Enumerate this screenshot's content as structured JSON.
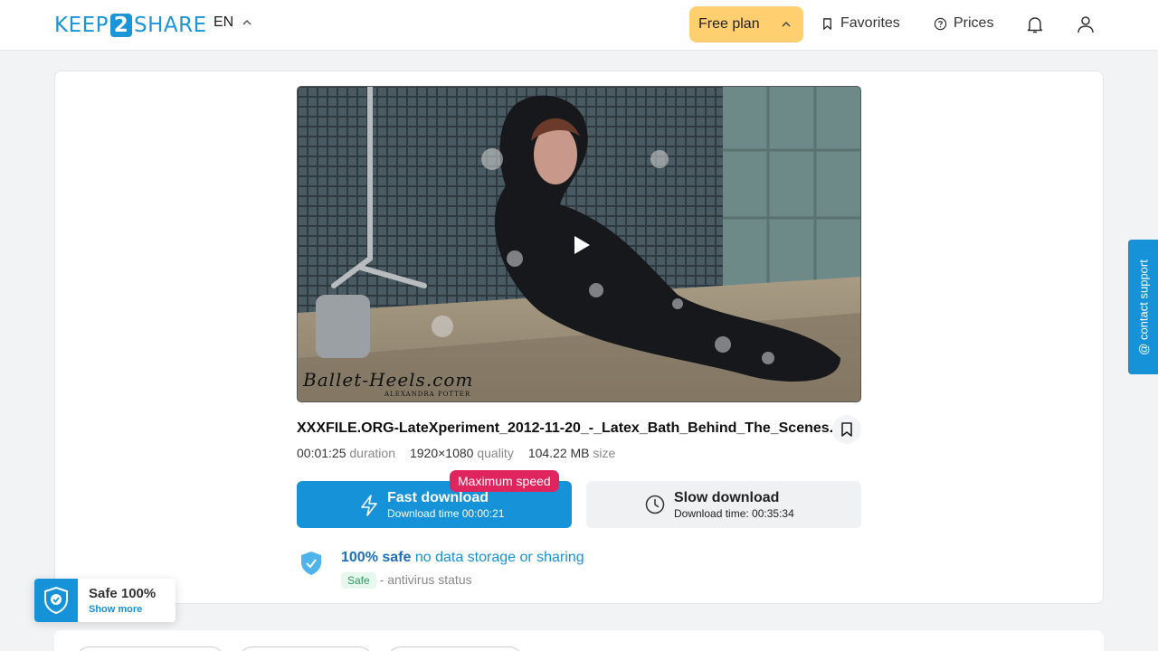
{
  "header": {
    "logo_left": "KEEP",
    "logo_mid": "2",
    "logo_right": "SHARE",
    "language": "EN",
    "plan_label": "Free plan",
    "favorites_label": "Favorites",
    "prices_label": "Prices"
  },
  "file": {
    "name": "XXXFILE.ORG-LateXperiment_2012-11-20_-_Latex_Bath_Behind_The_Scenes....",
    "duration_value": "00:01:25",
    "duration_label": "duration",
    "quality_value": "1920×1080",
    "quality_label": "quality",
    "size_value": "104.22 MB",
    "size_label": "size",
    "thumbnail_watermark": "Ballet-Heels.com",
    "thumbnail_watermark_sub": "ALEXANDRA POTTER"
  },
  "download": {
    "badge": "Maximum speed",
    "fast_title": "Fast download",
    "fast_sub": "Download time 00:00:21",
    "slow_title": "Slow download",
    "slow_sub": "Download time: 00:35:34"
  },
  "safety": {
    "bold": "100% safe",
    "rest": "no data storage or sharing",
    "status_pill": "Safe",
    "status_text": "- antivirus status"
  },
  "support_label": "@ contact support",
  "safe_widget": {
    "title": "Safe 100%",
    "more": "Show more"
  },
  "colors": {
    "brand": "#1592d8",
    "plan": "#ffcf70",
    "badge": "#e0245e",
    "safe_green": "#2c9a5c"
  }
}
